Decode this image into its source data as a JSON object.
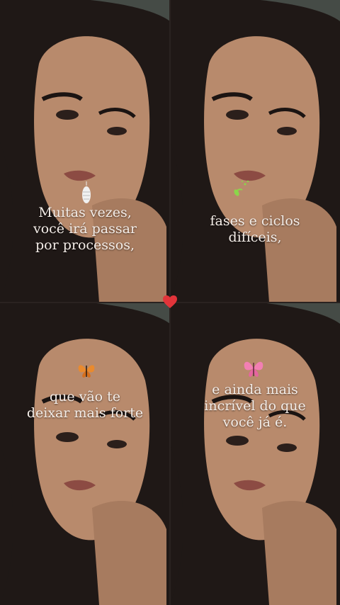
{
  "panels": [
    {
      "caption": "Muitas vezes,\nvocê irá passar\npor processos,",
      "icon": "cocoon-icon"
    },
    {
      "caption": "fases e ciclos\ndifíceis,",
      "icon": "sprout-icon"
    },
    {
      "caption": "que vão te\ndeixar mais forte",
      "icon": "orange-butterfly-icon"
    },
    {
      "caption": "e ainda mais\nincrível do que\nvocê já é.",
      "icon": "pink-butterfly-icon"
    }
  ],
  "center_icon": "heart-icon",
  "colors": {
    "hair": "#1f1816",
    "skin": "#b88a6c",
    "background": "#4a4f4a",
    "text": "#f4ede8",
    "heart": "#e2343a",
    "butterfly_pink": "#f27fb3",
    "butterfly_orange": "#e98a2e",
    "sprout": "#8bd64a"
  }
}
